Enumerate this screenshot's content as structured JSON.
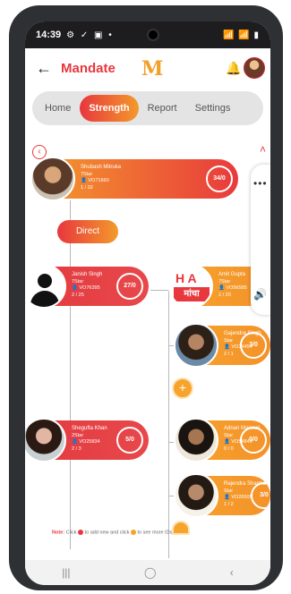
{
  "status": {
    "time": "14:39",
    "left_icons": "⚙ ✓ ▣ •",
    "right_icons": "📶 📶 ▮"
  },
  "header": {
    "title": "Mandate",
    "logo": "M"
  },
  "tabs": [
    "Home",
    "Strength",
    "Report",
    "Settings"
  ],
  "direct_label": "Direct",
  "nodes": {
    "root": {
      "name": "Shubash Mitruka",
      "level": "7Star",
      "id": "VO71660",
      "ratio": "1 / 32",
      "badge": "34/0"
    },
    "n1": {
      "name": "Janish Singh",
      "level": "7Star",
      "id": "VO76395",
      "ratio": "2 / 25",
      "badge": "27/0"
    },
    "n2": {
      "name": "Amit Gupta",
      "level": "7Star",
      "id": "VO56585",
      "ratio": "2 / 20",
      "badge": "..."
    },
    "n3": {
      "name": "Gajendra Singh",
      "level": "Star",
      "id": "VO34454",
      "ratio": "2 / 1",
      "badge": "3/0"
    },
    "n4": {
      "name": "Shegufta Khan",
      "level": "2Star",
      "id": "VO25834",
      "ratio": "2 / 3",
      "badge": "5/0"
    },
    "n5": {
      "name": "Adnan Mansuri",
      "level": "Star",
      "id": "VO54849",
      "ratio": "0 / 0",
      "badge": "0/0"
    },
    "n6": {
      "name": "Rajendra Sharma",
      "level": "Star",
      "id": "VO26505",
      "ratio": "1 / 2",
      "badge": "3/0"
    }
  },
  "logo_pic": {
    "line1": "H A",
    "line2": "मांचा"
  },
  "note": {
    "label": "Note:",
    "text1": " Click ",
    "text2": " to add new and click ",
    "text3": " to see more IDs"
  },
  "nav": {
    "recent": "|||",
    "home": "◯",
    "back": "‹"
  }
}
